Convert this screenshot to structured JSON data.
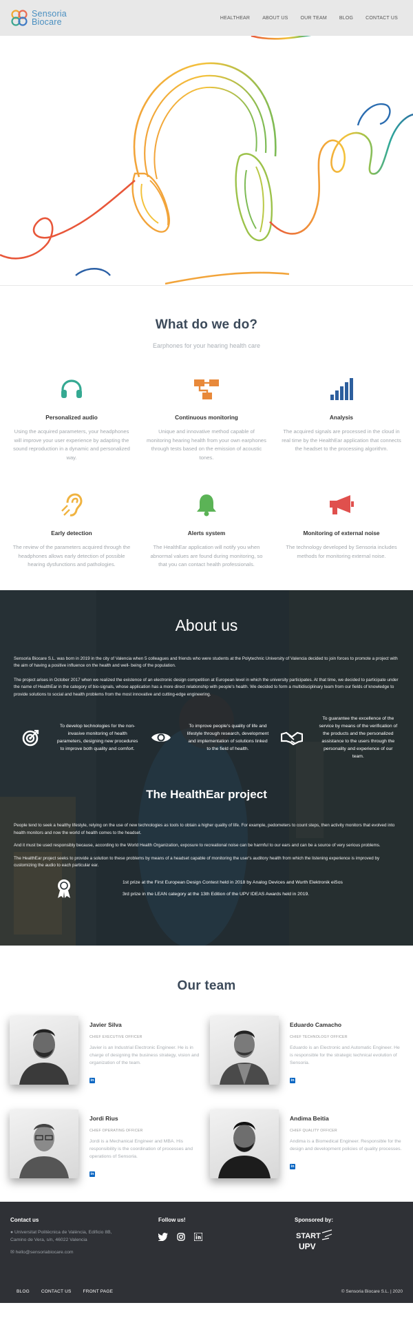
{
  "header": {
    "logo_line1": "Sensoria",
    "logo_line2": "Biocare",
    "nav": [
      "HEALTHEAR",
      "ABOUT US",
      "OUR TEAM",
      "BLOG",
      "CONTACT US"
    ]
  },
  "what": {
    "title": "What do we do?",
    "subtitle": "Earphones for your hearing health care",
    "features": [
      {
        "icon": "headphones-icon",
        "color": "#35a992",
        "title": "Personalized audio",
        "desc": "Using the acquired parameters, your headphones will improve your user experience by adapting the sound reproduction in a dynamic and personalized way."
      },
      {
        "icon": "sitemap-icon",
        "color": "#e8893a",
        "title": "Continuous monitoring",
        "desc": "Unique and innovative method capable of monitoring hearing health from your own earphones through tests based on the emission of acoustic tones."
      },
      {
        "icon": "signal-bars-icon",
        "color": "#2d5f9e",
        "title": "Analysis",
        "desc": "The acquired signals are processed in the cloud in real time by the HealthEar application that connects the headset to the processing algorithm."
      },
      {
        "icon": "ear-icon",
        "color": "#f0b340",
        "title": "Early detection",
        "desc": "The review of the parameters acquired through the headphones allows early detection of possible hearing dysfunctions and pathologies."
      },
      {
        "icon": "bell-icon",
        "color": "#5bb356",
        "title": "Alerts system",
        "desc": "The HealthEar application will notify you when abnormal values are found during monitoring, so that you can contact health professionals."
      },
      {
        "icon": "megaphone-icon",
        "color": "#e0504d",
        "title": "Monitoring of external noise",
        "desc": "The technology developed by Sensoria includes methods for monitoring external noise."
      }
    ]
  },
  "about": {
    "title": "About us",
    "p1": "Sensoria Biocare S.L. was born in 2019 in the city of Valencia when 5 colleagues and friends who were students at the Polytechnic University of Valencia decided to join forces to promote a project with the aim of having a positive influence on the health and well- being of the population.",
    "p2": "The project arises in October 2017 when we realized the existence of an electronic design competition at European level in which the university participates. At that time, we decided to participate under the name of HealthEar in the category of bio-signals, whose application has a more direct relationship with people's health. We decided to form a multidisciplinary team from our fields of knowledge to provide solutions to social and health problems from the most innovative and cutting-edge engineering.",
    "pillars": [
      {
        "icon": "target-icon",
        "text": "To develop technologies for the non-invasive monitoring of health parameters, designing new procedures to improve both quality and comfort."
      },
      {
        "icon": "eye-icon",
        "text": "To improve people's quality of life and lifestyle through research, development and implementation of solutions linked to the field of health."
      },
      {
        "icon": "handshake-icon",
        "text": "To guarantee the excellence of the service by means of the verification of the products and the personalized assistance to the users through the personality and experience of our team."
      }
    ],
    "healthear_title": "The HealthEar project",
    "he_p1": "People tend to seek a healthy lifestyle, relying on the use of new technologies as tools to obtain a higher quality of life. For example, pedometers to count steps, then activity monitors that evolved into health monitors and now the world of health comes to the headset.",
    "he_p2": "And it must be used responsibly because, according to the World Health Organization, exposure to recreational noise can be harmful to our ears and can be a source of very serious problems.",
    "he_p3": "The HealthEar project seeks to provide a solution to these problems by means of a headset capable of monitoring the user's auditory health from which the listening experience is improved by customizing the audio to each particular ear.",
    "awards": [
      "1st prize at the First European Design Contest held in 2018 by Analog Devices and Wurth Elektronik eiSos",
      "3rd prize in the LEAN category at the 13th Edition of the UPV IDEAS Awards held in 2019."
    ]
  },
  "team": {
    "title": "Our team",
    "members": [
      {
        "name": "Javier Silva",
        "role": "CHIEF EXECUTIVE OFFICER",
        "bio": "Javier is an Industrial Electronic Engineer. He is in charge of designing the business strategy, vision and organization of the team.",
        "linkedin": "in"
      },
      {
        "name": "Eduardo Camacho",
        "role": "CHIEF TECHNOLOGY OFFICER",
        "bio": "Eduardo is an Electronic and Automatic Engineer. He is responsible for the strategic technical evolution of Sensoria.",
        "linkedin": "in"
      },
      {
        "name": "Jordi Rius",
        "role": "CHIEF OPERATING OFFICER",
        "bio": "Jordi is a Mechanical Engineer and MBA. His responsibility is the coordination of processes and operations of Sensoria.",
        "linkedin": "in"
      },
      {
        "name": "Andima Beitia",
        "role": "CHIEF QUALITY OFFICER",
        "bio": "Andima is a Biomedical Engineer. Responsible for the design and development policies of quality processes.",
        "linkedin": "in"
      }
    ]
  },
  "footer": {
    "contact_title": "Contact us",
    "address_line1": "Universitat Politècnica de València, Edificio 8B,",
    "address_line2": "Camino de Vera, s/n, 46022 Valencia",
    "email": "hello@sensoriabiocare.com",
    "follow_title": "Follow us!",
    "sponsored_title": "Sponsored by:",
    "sponsor_logo_text": "START UPV",
    "bottom_links": [
      "BLOG",
      "CONTACT US",
      "FRONT PAGE"
    ],
    "copyright": "© Sensoria Biocare S.L. | 2020"
  }
}
